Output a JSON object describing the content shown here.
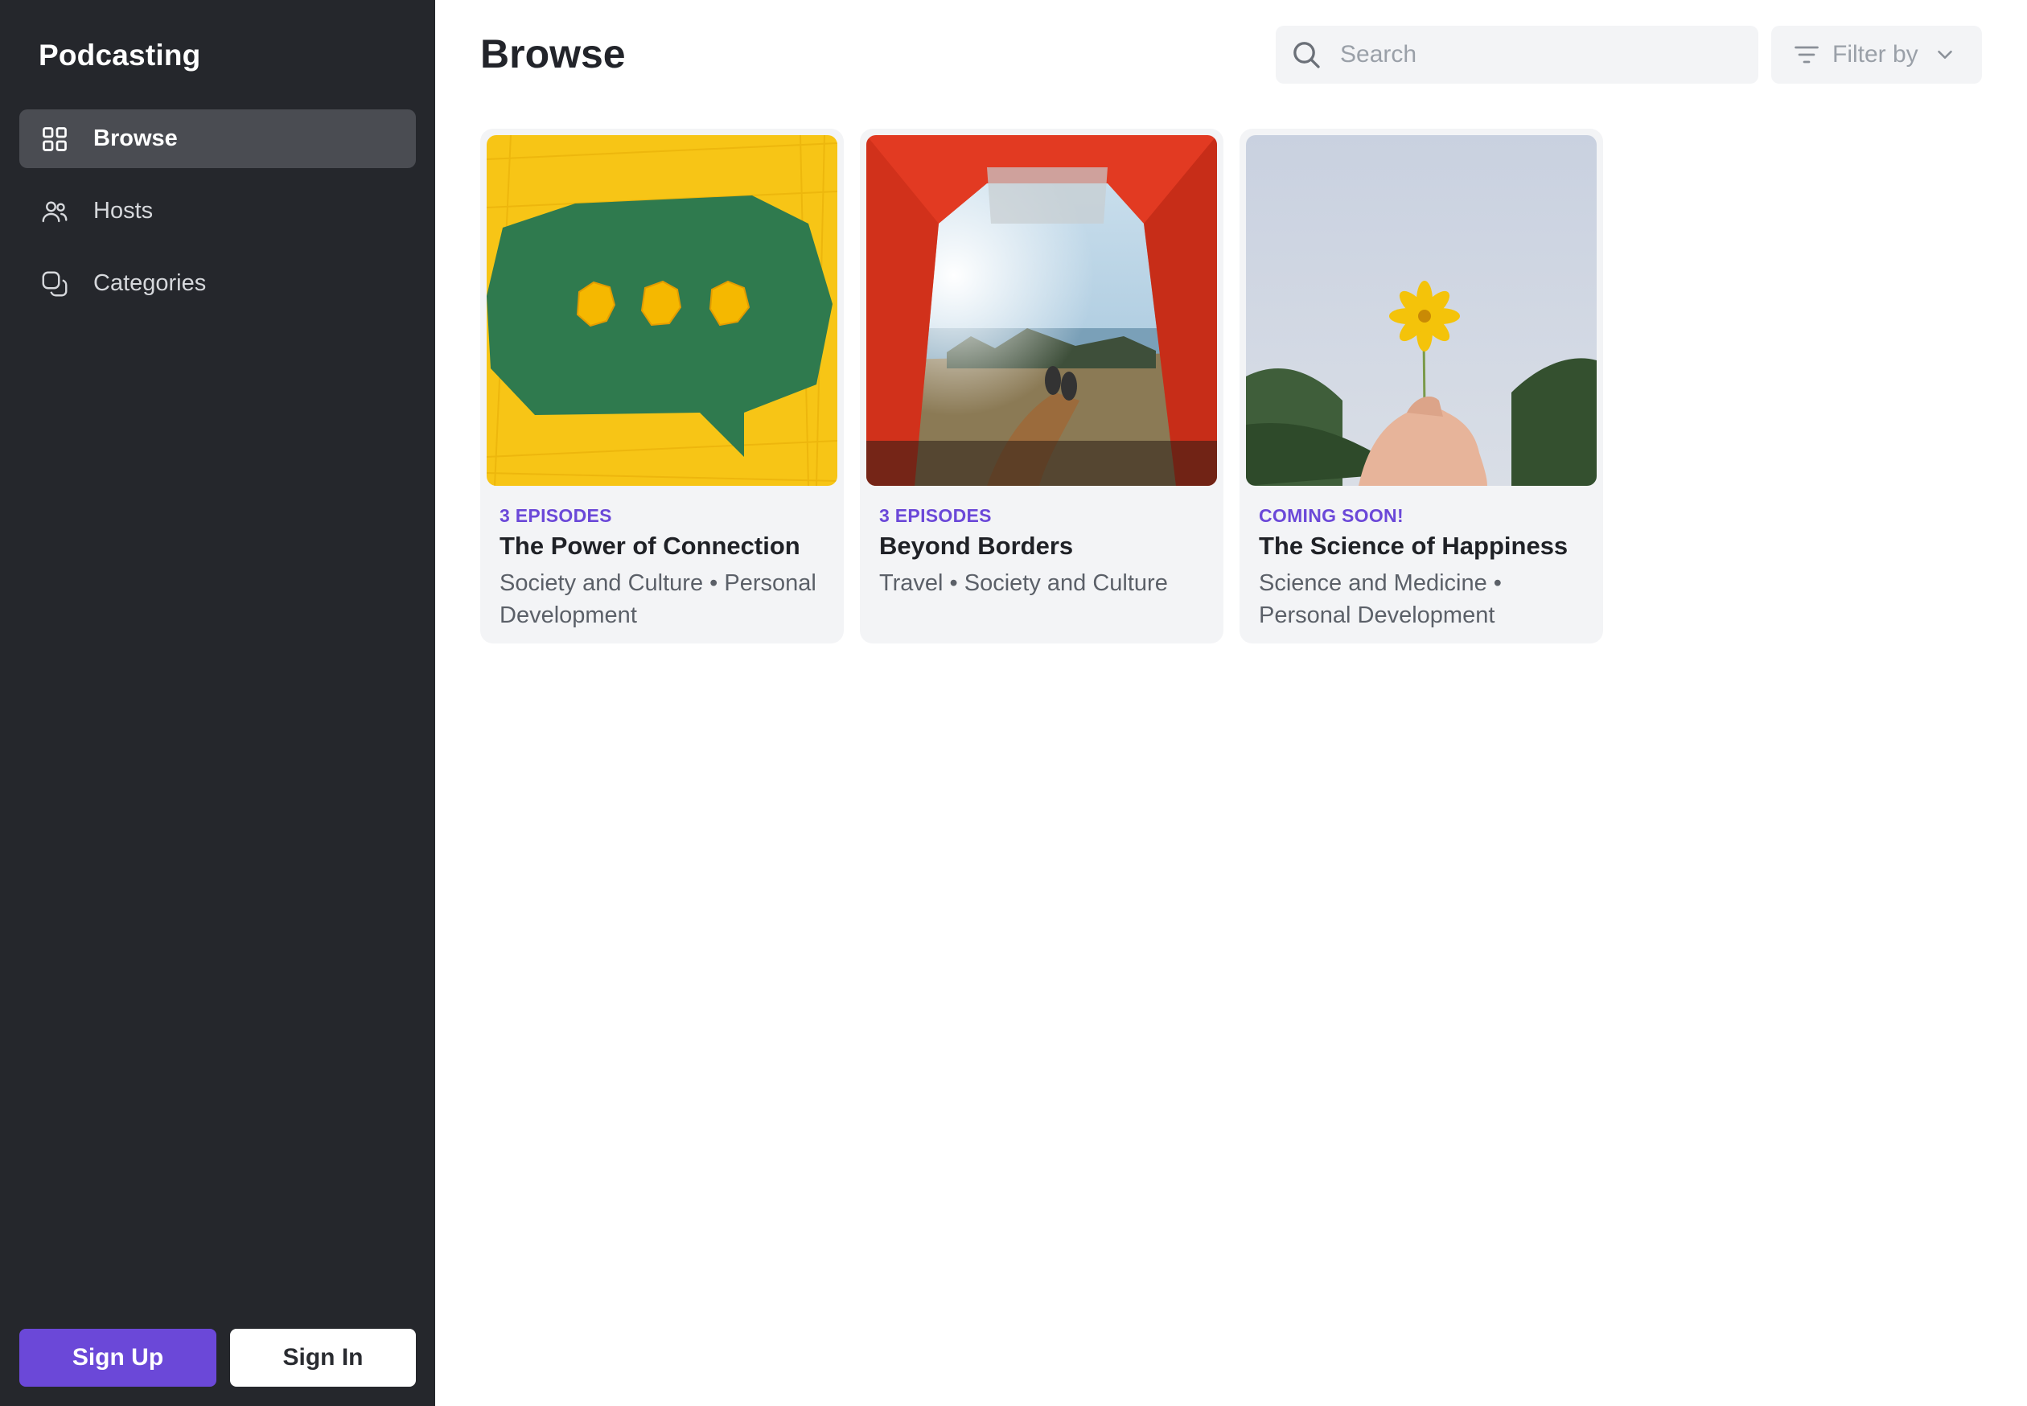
{
  "sidebar": {
    "brand": "Podcasting",
    "items": [
      {
        "label": "Browse",
        "icon": "grid-icon",
        "active": true
      },
      {
        "label": "Hosts",
        "icon": "users-icon",
        "active": false
      },
      {
        "label": "Categories",
        "icon": "categories-icon",
        "active": false
      }
    ],
    "signup_label": "Sign Up",
    "signin_label": "Sign In"
  },
  "header": {
    "title": "Browse",
    "search_placeholder": "Search",
    "filter_label": "Filter by"
  },
  "podcasts": [
    {
      "eyebrow": "3 EPISODES",
      "title": "The Power of Connection",
      "categories": "Society and Culture • Personal Development",
      "image": "speech-bubble-image"
    },
    {
      "eyebrow": "3 EPISODES",
      "title": "Beyond Borders",
      "categories": "Travel • Society and Culture",
      "image": "tent-view-image"
    },
    {
      "eyebrow": "COMING SOON!",
      "title": "The Science of Happiness",
      "categories": "Science and Medicine • Personal Development",
      "image": "flower-hand-image"
    }
  ],
  "colors": {
    "sidebar_bg": "#25272c",
    "accent": "#6b48d8",
    "card_bg": "#f3f4f6"
  }
}
